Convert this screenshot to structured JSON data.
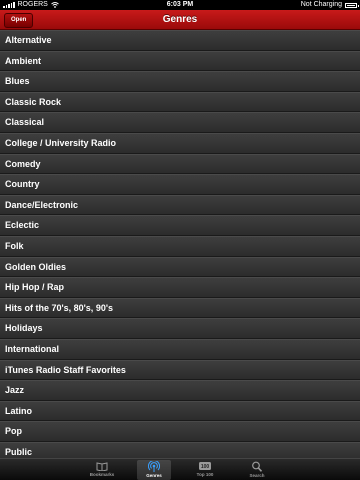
{
  "status_bar": {
    "carrier": "ROGERS",
    "time": "6:03 PM",
    "charging": "Not Charging"
  },
  "nav": {
    "title": "Genres",
    "open_label": "Open"
  },
  "genres": [
    "Alternative",
    "Ambient",
    "Blues",
    "Classic Rock",
    "Classical",
    "College / University Radio",
    "Comedy",
    "Country",
    "Dance/Electronic",
    "Eclectic",
    "Folk",
    "Golden Oldies",
    "Hip Hop / Rap",
    "Hits of the 70's, 80's, 90's",
    "Holidays",
    "International",
    "iTunes Radio Staff Favorites",
    "Jazz",
    "Latino",
    "Pop",
    "Public"
  ],
  "tabs": [
    {
      "label": "Bookmarks",
      "icon": "book-icon",
      "selected": false
    },
    {
      "label": "Genres",
      "icon": "broadcast-icon",
      "selected": true
    },
    {
      "label": "Top 100",
      "icon": "top100-icon",
      "badge": "100",
      "selected": false
    },
    {
      "label": "Search",
      "icon": "search-icon",
      "selected": false
    }
  ],
  "colors": {
    "nav_red": "#c81a1a",
    "row_bg": "#333333",
    "text": "#ffffff"
  }
}
